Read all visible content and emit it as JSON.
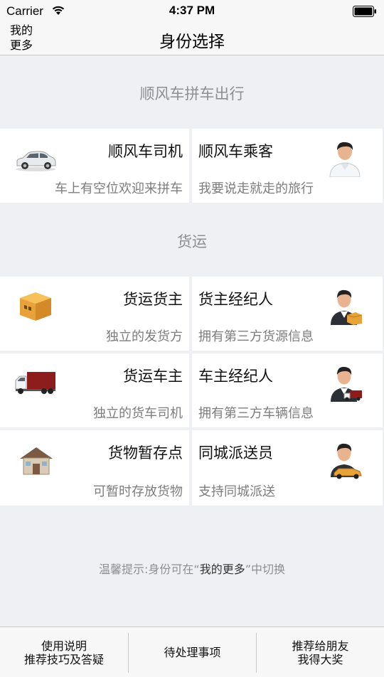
{
  "status_bar": {
    "carrier": "Carrier",
    "time": "4:37 PM"
  },
  "nav": {
    "left_line1": "我的",
    "left_line2": "更多",
    "title": "身份选择"
  },
  "sections": {
    "rideshare": "顺风车拼车出行",
    "freight": "货运"
  },
  "cards": {
    "driver": {
      "name": "顺风车司机",
      "desc": "车上有空位欢迎来拼车",
      "icon": "car-icon"
    },
    "passenger": {
      "name": "顺风车乘客",
      "desc": "我要说走就走的旅行",
      "icon": "passenger-icon"
    },
    "cargo_owner": {
      "name": "货运货主",
      "desc": "独立的发货方",
      "icon": "cardboard-box-icon"
    },
    "cargo_agent": {
      "name": "货主经纪人",
      "desc": "拥有第三方货源信息",
      "icon": "agent-with-box-icon"
    },
    "truck_owner": {
      "name": "货运车主",
      "desc": "独立的货车司机",
      "icon": "truck-icon"
    },
    "truck_agent": {
      "name": "车主经纪人",
      "desc": "拥有第三方车辆信息",
      "icon": "agent-with-truck-icon"
    },
    "storage": {
      "name": "货物暂存点",
      "desc": "可暂时存放货物",
      "icon": "warehouse-icon"
    },
    "courier": {
      "name": "同城派送员",
      "desc": "支持同城派送",
      "icon": "courier-icon"
    }
  },
  "hint": {
    "prefix": "温馨提示:身份可在“",
    "emphasis": "我的更多",
    "suffix": "”中切换"
  },
  "tab_bar": {
    "guide_line1": "使用说明",
    "guide_line2": "推荐技巧及答疑",
    "pending": "待处理事项",
    "refer_line1": "推荐给朋友",
    "refer_line2": "我得大奖"
  },
  "colors": {
    "background": "#eef0f3",
    "section_text": "#8b8f94",
    "desc_text": "#7d7d7d"
  }
}
